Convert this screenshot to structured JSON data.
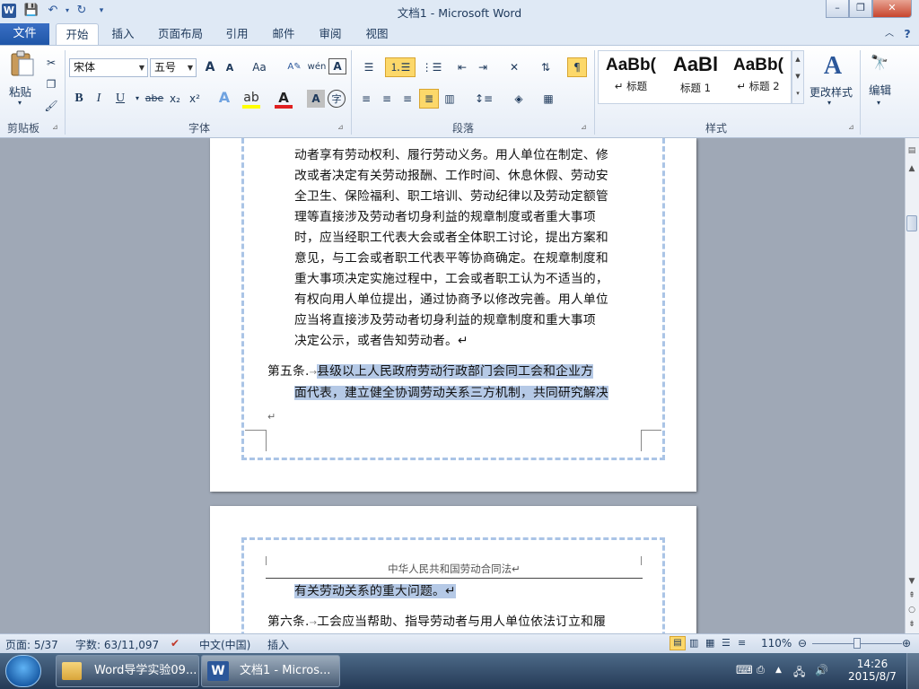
{
  "window": {
    "title": "文档1 - Microsoft Word",
    "controls": {
      "minimize": "–",
      "maximize": "❐",
      "close": "✕"
    }
  },
  "quick_access": {
    "app_icon": "word-icon",
    "items": [
      "save-icon",
      "undo-icon",
      "redo-icon",
      "customize-icon"
    ]
  },
  "tabs": {
    "file": "文件",
    "items": [
      "开始",
      "插入",
      "页面布局",
      "引用",
      "邮件",
      "审阅",
      "视图"
    ],
    "active": "开始"
  },
  "ribbon": {
    "clipboard": {
      "paste": "粘贴",
      "label": "剪贴板"
    },
    "font": {
      "name": "宋体",
      "size": "五号",
      "grow": "A",
      "shrink": "A",
      "case": "Aa",
      "phonetic": "wén",
      "char_border": "A",
      "bold": "B",
      "italic": "I",
      "underline": "U",
      "strike": "abe",
      "subscript": "x₂",
      "superscript": "x²",
      "label": "字体"
    },
    "paragraph": {
      "label": "段落"
    },
    "styles": {
      "items": [
        {
          "sample": "AaBb(",
          "name": "↵ 标题"
        },
        {
          "sample": "AaBl",
          "name": "标题 1"
        },
        {
          "sample": "AaBb(",
          "name": "↵ 标题 2"
        }
      ],
      "change": "更改样式",
      "label": "样式"
    },
    "editing": {
      "label": "编辑"
    }
  },
  "document": {
    "page1_lines": [
      "动者享有劳动权利、履行劳动义务。用人单位在制定、修",
      "改或者决定有关劳动报酬、工作时间、休息休假、劳动安",
      "全卫生、保险福利、职工培训、劳动纪律以及劳动定额管",
      "理等直接涉及劳动者切身利益的规章制度或者重大事项",
      "时，应当经职工代表大会或者全体职工讨论，提出方案和",
      "意见，与工会或者职工代表平等协商确定。在规章制度和",
      "重大事项决定实施过程中，工会或者职工认为不适当的，",
      "有权向用人单位提出，通过协商予以修改完善。用人单位",
      "应当将直接涉及劳动者切身利益的规章制度和重大事项",
      "决定公示，或者告知劳动者。↵"
    ],
    "article5": {
      "label": "第五条.",
      "arrow": "→",
      "line1": "县级以上人民政府劳动行政部门会同工会和企业方",
      "line2": "面代表，建立健全协调劳动关系三方机制，共同研究解决"
    },
    "empty_mark": "↵",
    "page2_header": "中华人民共和国劳动合同法↵",
    "page2_line1": "有关劳动关系的重大问题。↵",
    "article6": {
      "label": "第六条.",
      "arrow": "→",
      "line1": "工会应当帮助、指导劳动者与用人单位依法订立和履"
    }
  },
  "status": {
    "page": "页面: 5/37",
    "words": "字数: 63/11,097",
    "language": "中文(中国)",
    "insert": "插入",
    "zoom": "110%"
  },
  "taskbar": {
    "items": [
      {
        "label": "Word导学实验09...",
        "icon": "folder-icon"
      },
      {
        "label": "文档1 - Micros...",
        "icon": "word-icon"
      }
    ],
    "time": "14:26",
    "date": "2015/8/7"
  },
  "colors": {
    "selection": "#b5c9e6",
    "accent": "#2b579a",
    "file_tab": "#1f56a8"
  }
}
